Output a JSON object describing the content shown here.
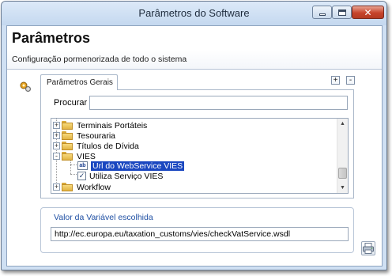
{
  "window": {
    "title": "Parâmetros do Software",
    "minimize_icon": "minimize-icon",
    "maximize_icon": "maximize-icon",
    "close_icon": "close-icon",
    "close_color": "#c7442c"
  },
  "header": {
    "title": "Parâmetros",
    "subtitle": "Configuração pormenorizada de todo o sistema"
  },
  "tabs": [
    {
      "label": "Parâmetros Gerais",
      "active": true
    }
  ],
  "tab_buttons": {
    "expand": "+",
    "collapse": "-"
  },
  "search": {
    "label": "Procurar :",
    "value": "",
    "placeholder": ""
  },
  "tree": {
    "items": [
      {
        "label": "Terminais Portáteis",
        "type": "folder",
        "expanded": false,
        "level": 0
      },
      {
        "label": "Tesouraria",
        "type": "folder",
        "expanded": false,
        "level": 0
      },
      {
        "label": "Títulos de Dívida",
        "type": "folder",
        "expanded": false,
        "level": 0
      },
      {
        "label": "VIES",
        "type": "folder",
        "expanded": true,
        "level": 0
      },
      {
        "label": "Url do WebService VIES",
        "type": "text-setting",
        "selected": true,
        "level": 1,
        "icon_text": "ab"
      },
      {
        "label": "Utiliza Serviço VIES",
        "type": "checkbox-setting",
        "selected": false,
        "level": 1,
        "checked": true
      },
      {
        "label": "Workflow",
        "type": "folder",
        "expanded": false,
        "level": 0
      }
    ],
    "expand_symbol": "+",
    "collapse_symbol": "-",
    "scroll_up": "▲",
    "scroll_down": "▼",
    "selection_color": "#1a47c0"
  },
  "variable": {
    "title": "Valor da Variável escolhida",
    "value": "http://ec.europa.eu/taxation_customs/vies/checkVatService.wsdl"
  },
  "accent_color": "#1e4fa3"
}
